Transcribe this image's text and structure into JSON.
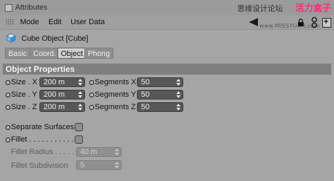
{
  "window": {
    "title": "Attributes"
  },
  "watermark": {
    "cn": "思缘设计论坛",
    "brand": "活力盒子",
    "url": "www.MISSYUAN.com"
  },
  "menu": {
    "items": [
      "Mode",
      "Edit",
      "User Data"
    ]
  },
  "object": {
    "name": "Cube Object [Cube]"
  },
  "tabs": [
    {
      "label": "Basic",
      "active": false
    },
    {
      "label": "Coord.",
      "active": false
    },
    {
      "label": "Object",
      "active": true
    },
    {
      "label": "Phong",
      "active": false
    }
  ],
  "section": {
    "title": "Object Properties"
  },
  "size": {
    "x_label": "Size . X",
    "x_value": "200 m",
    "y_label": "Size . Y",
    "y_value": "200 m",
    "z_label": "Size . Z",
    "z_value": "200 m"
  },
  "segments": {
    "x_label": "Segments X",
    "x_value": "50",
    "y_label": "Segments Y",
    "y_value": "50",
    "z_label": "Segments Z",
    "z_value": "50"
  },
  "separate_surfaces": {
    "label": "Separate Surfaces",
    "checked": false
  },
  "fillet": {
    "label": "Fillet . . . . . . . . . . . .",
    "checked": false
  },
  "fillet_radius": {
    "label": "Fillet Radius . . . . .",
    "value": "40 m"
  },
  "fillet_subdivision": {
    "label": "Fillet Subdivision",
    "value": "5"
  },
  "colors": {
    "accent": "#ff2a7a",
    "panel": "#a5a5a5",
    "field": "#575757",
    "header": "#7f7f7f"
  }
}
